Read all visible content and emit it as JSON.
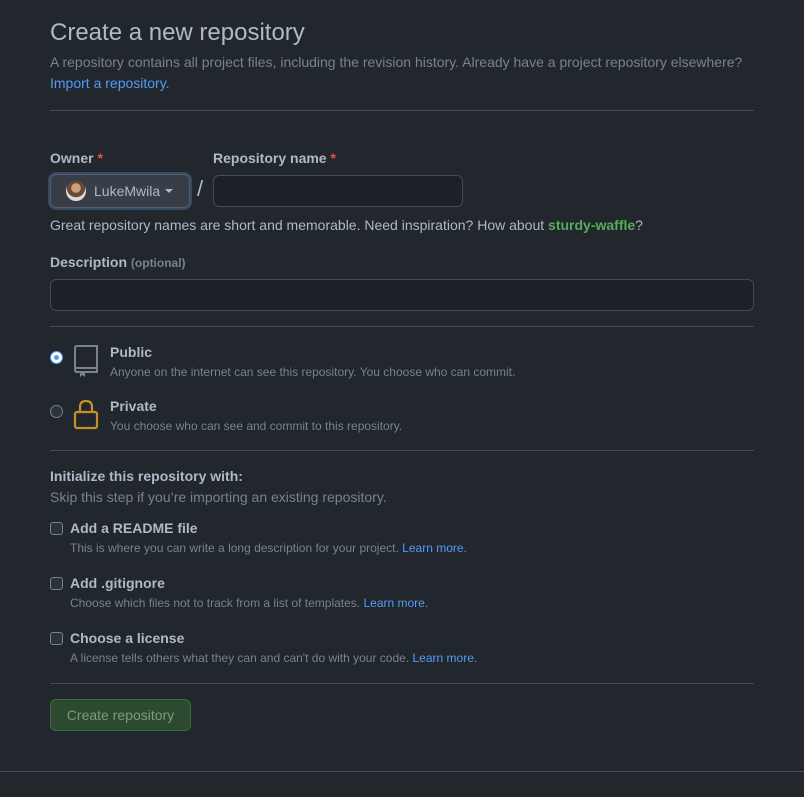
{
  "header": {
    "title": "Create a new repository",
    "subtitle": "A repository contains all project files, including the revision history. Already have a project repository elsewhere?",
    "import_link": "Import a repository."
  },
  "owner": {
    "label": "Owner",
    "required_mark": "*",
    "value": "LukeMwila",
    "separator": "/"
  },
  "repository": {
    "label": "Repository name",
    "required_mark": "*",
    "value": "",
    "hint_prefix": "Great repository names are short and memorable. Need inspiration? How about ",
    "suggestion": "sturdy-waffle",
    "hint_suffix": "?"
  },
  "description": {
    "label": "Description",
    "optional": "(optional)",
    "value": ""
  },
  "visibility": [
    {
      "title": "Public",
      "description": "Anyone on the internet can see this repository. You choose who can commit.",
      "icon": "repo-icon",
      "checked": true
    },
    {
      "title": "Private",
      "description": "You choose who can see and commit to this repository.",
      "icon": "lock-icon",
      "checked": false
    }
  ],
  "initialize": {
    "title": "Initialize this repository with:",
    "subtitle": "Skip this step if you’re importing an existing repository.",
    "options": [
      {
        "title": "Add a README file",
        "description": "This is where you can write a long description for your project.",
        "link": "Learn more.",
        "checked": false
      },
      {
        "title": "Add .gitignore",
        "description": "Choose which files not to track from a list of templates.",
        "link": "Learn more.",
        "checked": false
      },
      {
        "title": "Choose a license",
        "description": "A license tells others what they can and can't do with your code.",
        "link": "Learn more.",
        "checked": false
      }
    ]
  },
  "submit": {
    "label": "Create repository"
  },
  "colors": {
    "background": "#22272e",
    "accent_link": "#539bf5",
    "suggestion_green": "#57ab5a",
    "required_red": "#e5534b",
    "private_lock": "#c69026"
  }
}
